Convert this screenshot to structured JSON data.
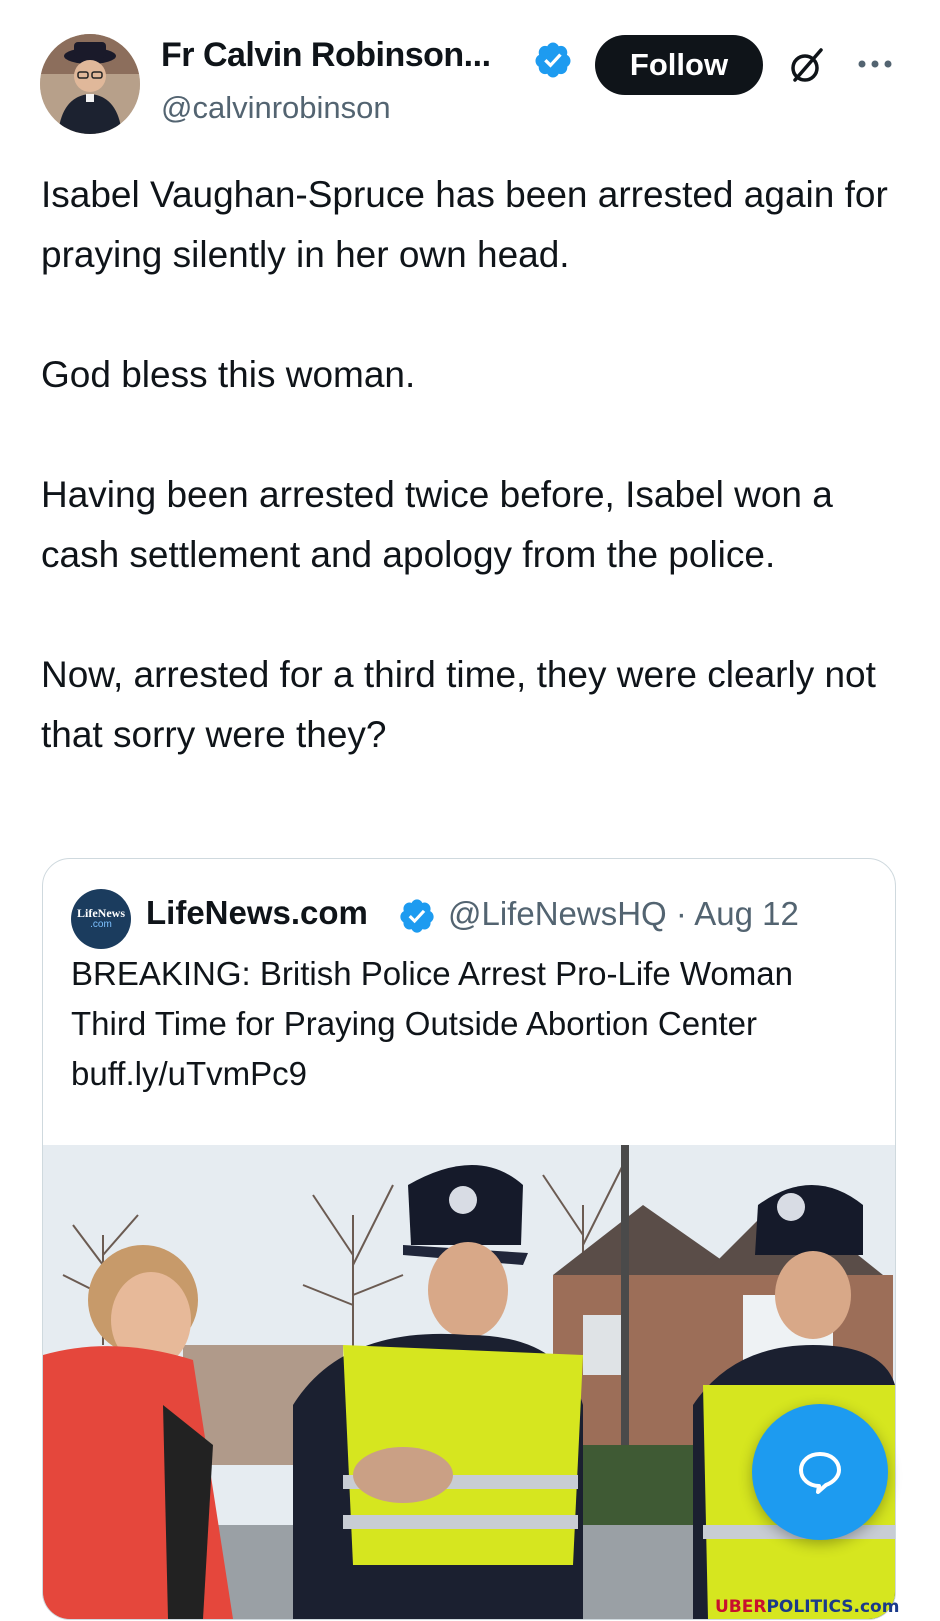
{
  "author": {
    "display_name": "Fr Calvin Robinson...",
    "handle": "@calvinrobinson",
    "verified": true
  },
  "actions": {
    "follow_label": "Follow",
    "grok_icon": "grok-icon",
    "more_icon": "more-options-icon"
  },
  "tweet": {
    "paragraphs": [
      "Isabel Vaughan-Spruce has been arrested again for praying silently in her own head.",
      "God bless this woman.",
      "Having been arrested twice before, Isabel won a cash settlement and apology from the police.",
      "Now, arrested for a third time, they were clearly not that sorry were they?"
    ]
  },
  "quoted_tweet": {
    "avatar_text_1": "LifeNews",
    "avatar_text_2": ".com",
    "display_name": "LifeNews.com",
    "handle_and_date": "@LifeNewsHQ · Aug 12",
    "verified": true,
    "text": "BREAKING: British Police Arrest Pro-Life Woman Third Time for Praying Outside Abortion Center buff.ly/uTvmPc9",
    "image_alt": "Woman in red coat with two police officers in yellow hi-vis jackets on a residential street"
  },
  "floating_action": {
    "icon": "chat-bubble-icon"
  },
  "watermark": {
    "part1": "UBER",
    "part2": "POLITICS.com"
  },
  "colors": {
    "accent": "#1d9bf0",
    "text": "#0f1419",
    "secondary": "#536471",
    "follow_bg": "#0f1419"
  }
}
